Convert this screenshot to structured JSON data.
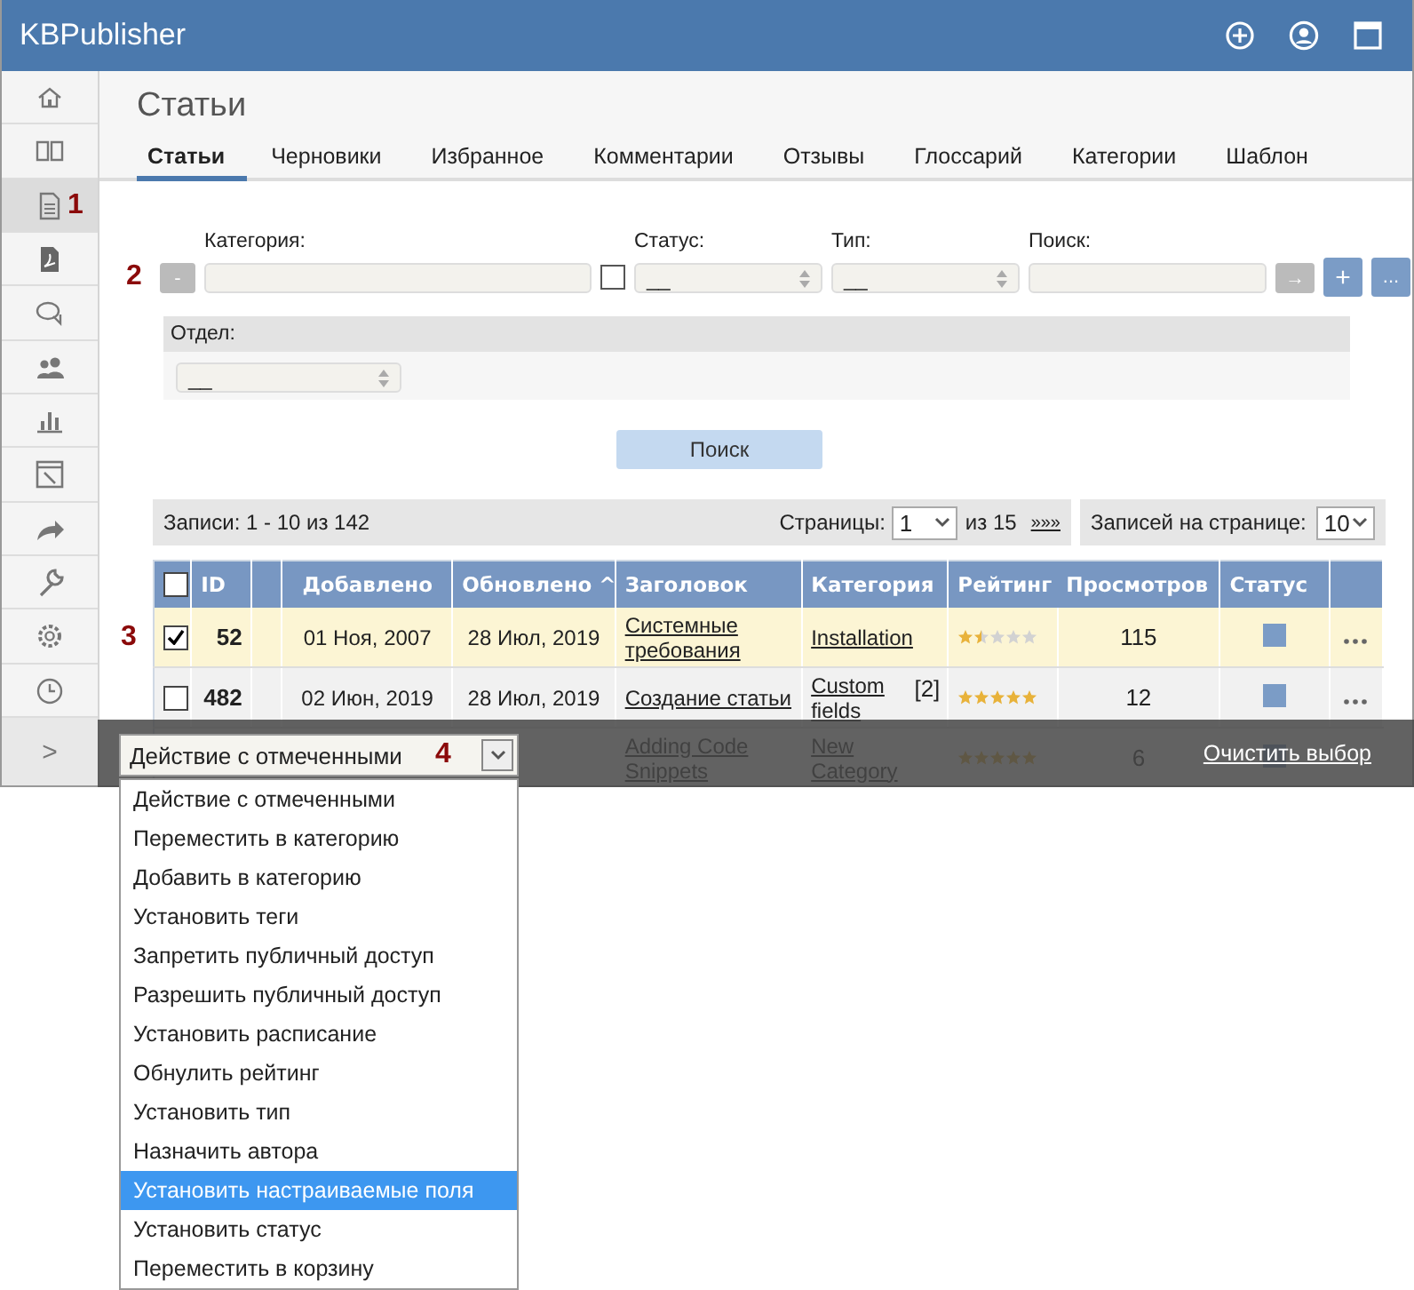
{
  "header": {
    "logo": "KBPublisher"
  },
  "sidebar": {
    "items": [
      {
        "selected": false
      },
      {
        "selected": false
      },
      {
        "selected": true,
        "marker": "1"
      },
      {
        "selected": false
      },
      {
        "selected": false
      },
      {
        "selected": false
      },
      {
        "selected": false
      },
      {
        "selected": false
      },
      {
        "selected": false
      },
      {
        "selected": false
      },
      {
        "selected": false
      },
      {
        "selected": false
      }
    ],
    "expand": ">"
  },
  "page_title": "Статьи",
  "tabs": [
    {
      "label": "Статьи",
      "selected": true
    },
    {
      "label": "Черновики",
      "selected": false
    },
    {
      "label": "Избранное",
      "selected": false
    },
    {
      "label": "Комментарии",
      "selected": false
    },
    {
      "label": "Отзывы",
      "selected": false
    },
    {
      "label": "Глоссарий",
      "selected": false
    },
    {
      "label": "Категории",
      "selected": false
    },
    {
      "label": "Шаблон",
      "selected": false
    }
  ],
  "filters": {
    "marker": "2",
    "minus": "-",
    "category_label": "Категория:",
    "checked": false,
    "status_label": "Статус:",
    "status_value": "__",
    "type_label": "Тип:",
    "type_value": "__",
    "search_label": "Поиск:",
    "go": "→",
    "plus": "+",
    "more": "...",
    "department_label": "Отдел:",
    "department_value": "__",
    "search_button": "Поиск"
  },
  "records": {
    "summary": "Записи: 1 - 10 из 142",
    "pages_label": "Страницы:",
    "page": "1",
    "of": "из 15",
    "next": "»»»",
    "per_page_label": "Записей на странице:",
    "per_page": "10"
  },
  "table": {
    "marker": "3",
    "all_checked": false,
    "columns": [
      "ID",
      "",
      "Добавлено",
      "Обновлено ^",
      "Заголовок",
      "Категория",
      "Рейтинг",
      "Просмотров",
      "Статус"
    ],
    "rows": [
      {
        "checked": true,
        "id": "52",
        "added": "01 Ноя, 2007",
        "updated": "28 Июл, 2019",
        "title": "Системные требования",
        "category": "Installation",
        "count": "",
        "stars": 1.5,
        "views": "115",
        "menu": true
      },
      {
        "checked": false,
        "id": "482",
        "added": "02 Июн, 2019",
        "updated": "28 Июл, 2019",
        "title": "Создание статьи",
        "category": "Custom fields",
        "count": "[2]",
        "stars": 5,
        "views": "12",
        "menu": true
      },
      {
        "id": "",
        "added": "",
        "updated": "",
        "title": "Adding Code Snippets",
        "category": "New Category",
        "count": "",
        "stars": 5,
        "views": "6",
        "menu": false
      }
    ]
  },
  "action_bar": {
    "marker": "4",
    "select_value": "Действие с отмеченными",
    "clear": "Очистить выбор",
    "options": [
      {
        "label": "Действие с отмеченными",
        "selected": false
      },
      {
        "label": "Переместить в категорию",
        "selected": false
      },
      {
        "label": "Добавить в категорию",
        "selected": false
      },
      {
        "label": "Установить теги",
        "selected": false
      },
      {
        "label": "Запретить публичный доступ",
        "selected": false
      },
      {
        "label": "Разрешить публичный доступ",
        "selected": false
      },
      {
        "label": "Установить расписание",
        "selected": false
      },
      {
        "label": "Обнулить рейтинг",
        "selected": false
      },
      {
        "label": "Установить тип",
        "selected": false
      },
      {
        "label": "Назначить автора",
        "selected": false
      },
      {
        "label": "Установить настраиваемые поля",
        "selected": true
      },
      {
        "label": "Установить статус",
        "selected": false
      },
      {
        "label": "Переместить в корзину",
        "selected": false
      }
    ]
  }
}
